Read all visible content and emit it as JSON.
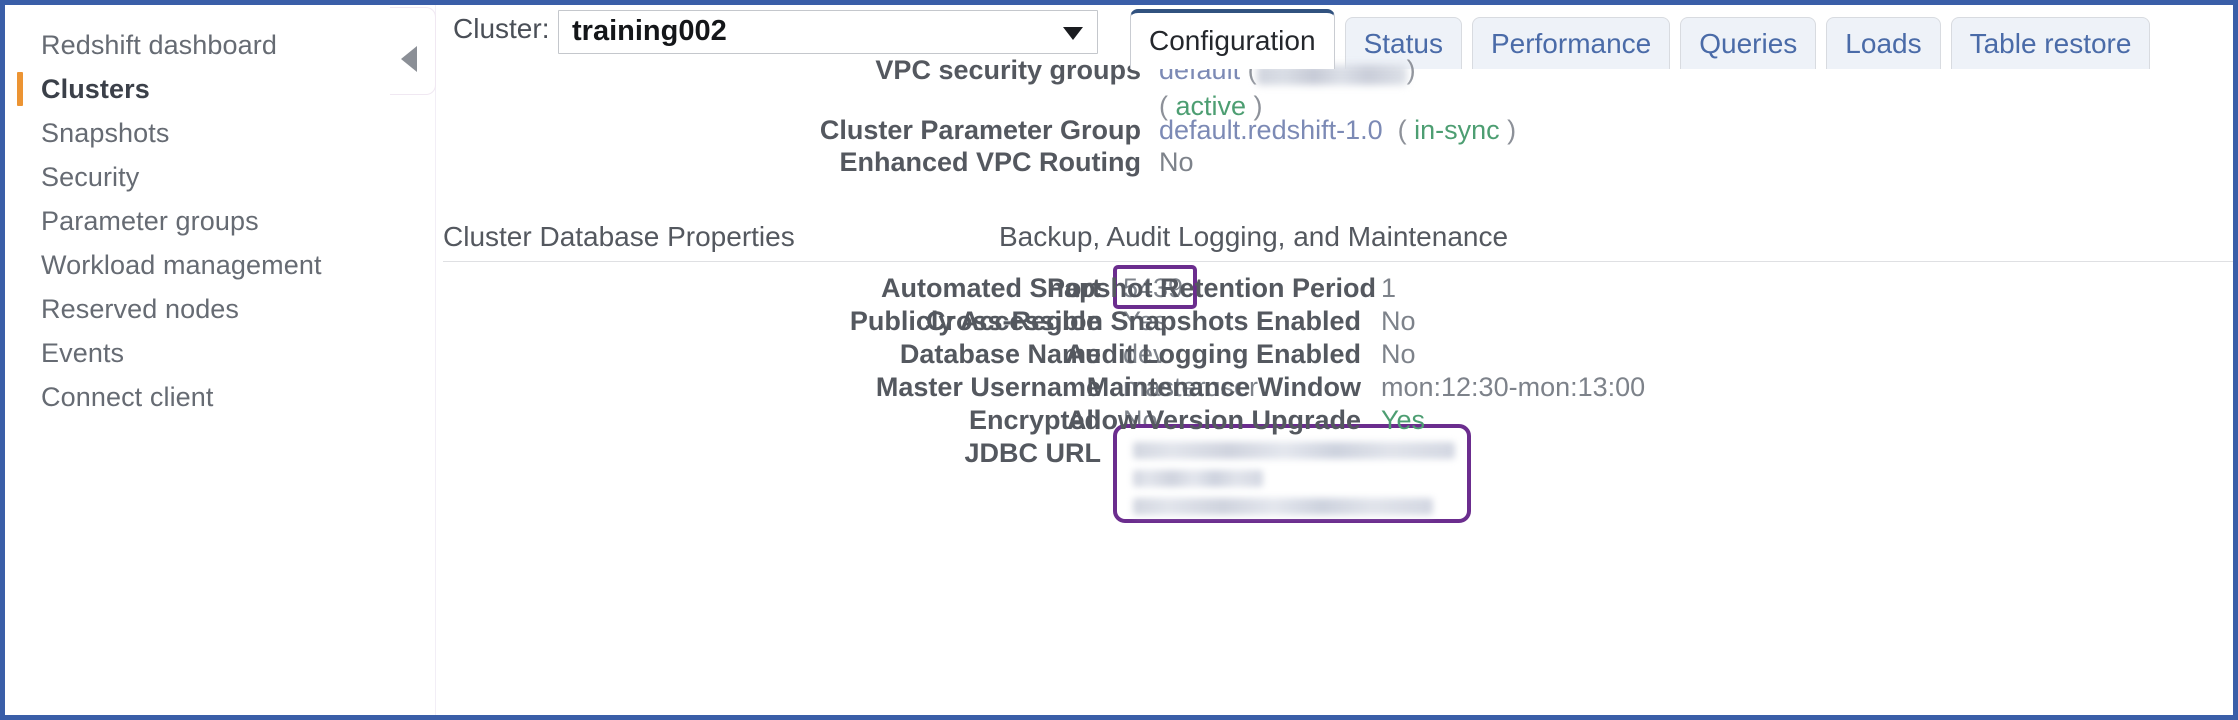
{
  "window": {
    "border_color": "#3a5ea8"
  },
  "sidebar": {
    "items": [
      {
        "label": "Redshift dashboard",
        "active": false
      },
      {
        "label": "Clusters",
        "active": true
      },
      {
        "label": "Snapshots",
        "active": false
      },
      {
        "label": "Security",
        "active": false
      },
      {
        "label": "Parameter groups",
        "active": false
      },
      {
        "label": "Workload management",
        "active": false
      },
      {
        "label": "Reserved nodes",
        "active": false
      },
      {
        "label": "Events",
        "active": false
      },
      {
        "label": "Connect client",
        "active": false
      }
    ],
    "active_marker_color": "#ec9433",
    "collapse_icon": "left-triangle-icon"
  },
  "toolbar": {
    "cluster_label": "Cluster:",
    "cluster_selected": "training002",
    "cluster_caret_icon": "chevron-down-icon"
  },
  "tabs": [
    {
      "label": "Configuration",
      "active": true
    },
    {
      "label": "Status",
      "active": false
    },
    {
      "label": "Performance",
      "active": false
    },
    {
      "label": "Queries",
      "active": false
    },
    {
      "label": "Loads",
      "active": false
    },
    {
      "label": "Table restore",
      "active": false
    }
  ],
  "top_properties": [
    {
      "label": "VPC security groups",
      "value_prefix": "default",
      "value_redacted": true,
      "status": "active",
      "status_color": "#4d9e72"
    },
    {
      "label": "Cluster Parameter Group",
      "value": "default.redshift-1.0",
      "status": "in-sync",
      "status_color": "#4d9e72"
    },
    {
      "label": "Enhanced VPC Routing",
      "value": "No"
    }
  ],
  "database_properties": {
    "title": "Cluster Database Properties",
    "rows": [
      {
        "label": "Port",
        "value": "5439",
        "highlighted": true
      },
      {
        "label": "Publicly Accessible",
        "value": "Yes"
      },
      {
        "label": "Database Name",
        "value": "dev"
      },
      {
        "label": "Master Username",
        "value": "masteruser"
      },
      {
        "label": "Encrypted",
        "value": "No"
      },
      {
        "label": "JDBC URL",
        "value": "",
        "redacted": true,
        "highlighted": true
      }
    ]
  },
  "backup_properties": {
    "title": "Backup, Audit Logging, and Maintenance",
    "rows": [
      {
        "label": "Automated Snapshot Retention Period",
        "value": "1"
      },
      {
        "label": "Cross-Region Snapshots Enabled",
        "value": "No"
      },
      {
        "label": "Audit Logging Enabled",
        "value": "No"
      },
      {
        "label": "Maintenance Window",
        "value": "mon:12:30-mon:13:00"
      },
      {
        "label": "Allow Version Upgrade",
        "value": "Yes",
        "color": "#4d9e72"
      }
    ]
  },
  "highlight_color": "#6b2d8e"
}
